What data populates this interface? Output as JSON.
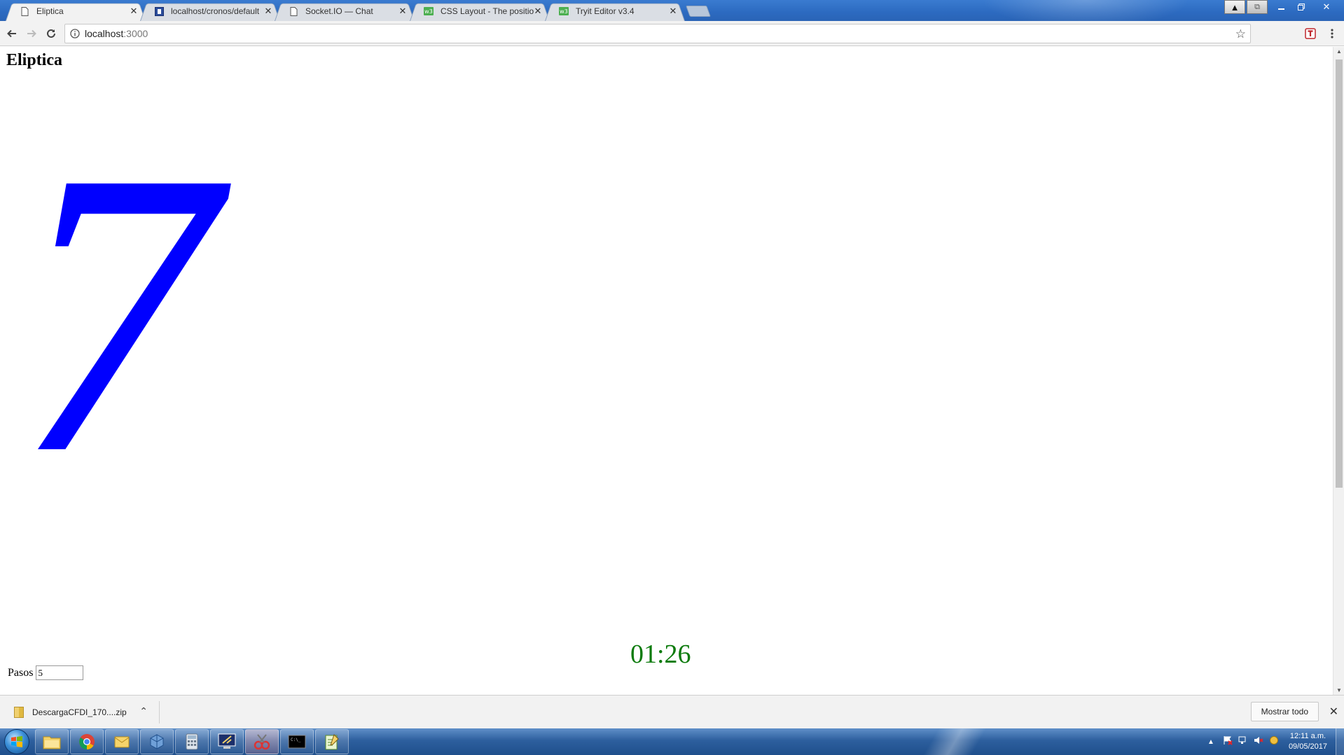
{
  "browser": {
    "tabs": [
      {
        "title": "Eliptica",
        "icon": "document-icon",
        "active": true
      },
      {
        "title": "localhost/cronos/default",
        "icon": "bookmark-icon",
        "active": false
      },
      {
        "title": "Socket.IO — Chat",
        "icon": "document-icon",
        "active": false
      },
      {
        "title": "CSS Layout - The positio",
        "icon": "w3-icon",
        "active": false
      },
      {
        "title": "Tryit Editor v3.4",
        "icon": "w3-icon",
        "active": false
      }
    ],
    "url_host": "localhost",
    "url_port": ":3000"
  },
  "page": {
    "heading": "Eliptica",
    "counter": "7",
    "timer": "01:26",
    "steps_label": "Pasos",
    "steps_value": "5"
  },
  "downloads": {
    "file_name": "DescargaCFDI_170....zip",
    "show_all": "Mostrar todo"
  },
  "taskbar": {
    "apps": [
      "file-explorer-icon",
      "chrome-icon",
      "outlook-icon",
      "virtualbox-icon",
      "calculator-icon",
      "remote-desktop-icon",
      "snipping-tool-icon",
      "terminal-icon",
      "notepad-icon"
    ],
    "time": "12:11 a.m.",
    "date": "09/05/2017"
  },
  "colors": {
    "counter": "#0000ff",
    "timer": "#0a7a0a"
  }
}
